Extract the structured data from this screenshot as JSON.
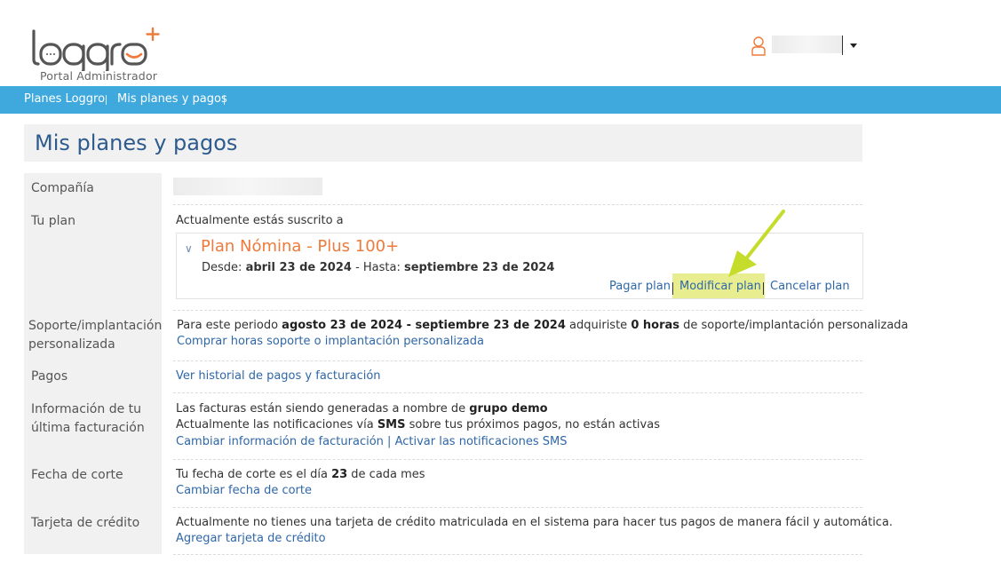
{
  "header": {
    "logo_text": "loggro",
    "logo_subtitle": "Portal Administrador",
    "user_menu": {
      "name": ""
    }
  },
  "breadcrumb": {
    "items": [
      {
        "label": "Planes Loggro"
      },
      {
        "label": "Mis planes y pagos"
      }
    ]
  },
  "page": {
    "title": "Mis planes y pagos"
  },
  "rows": {
    "company": {
      "label": "Compañía",
      "value": ""
    },
    "plan": {
      "label": "Tu plan",
      "intro": "Actualmente estás suscrito a",
      "name": "Plan Nómina - Plus 100+",
      "from_label": "Desde:",
      "from_date": "abril 23 de 2024",
      "sep": " - Hasta: ",
      "to_date": "septiembre 23 de 2024",
      "actions": {
        "pay": "Pagar plan",
        "modify": "Modificar plan",
        "cancel": "Cancelar plan"
      }
    },
    "support": {
      "label_line1": "Soporte/implantación",
      "label_line2": "personalizada",
      "text_1": "Para este periodo ",
      "period": "agosto 23 de 2024 - septiembre 23 de 2024",
      "text_2": " adquiriste ",
      "hours": "0 horas",
      "text_3": " de soporte/implantación personalizada",
      "link": "Comprar horas soporte o implantación personalizada"
    },
    "payments": {
      "label": "Pagos",
      "link": "Ver historial de pagos y facturación"
    },
    "billing": {
      "label_line1": "Información de tu",
      "label_line2": "última facturación",
      "text_1": "Las facturas están siendo generadas a nombre de ",
      "group": "grupo demo",
      "text_2": "Actualmente las notificaciones vía ",
      "sms": "SMS",
      "text_3": " sobre tus próximos pagos, no están activas",
      "link_1": "Cambiar información de facturación",
      "link_sep": " | ",
      "link_2": "Activar las notificaciones SMS"
    },
    "cutoff": {
      "label": "Fecha de corte",
      "text_1": "Tu fecha de corte es el día ",
      "day": "23",
      "text_2": " de cada mes",
      "link": "Cambiar fecha de corte"
    },
    "card": {
      "label": "Tarjeta de crédito",
      "text": "Actualmente no tienes una tarjeta de crédito matriculada en el sistema para hacer tus pagos de manera fácil y automática.",
      "link": "Agregar tarjeta de crédito"
    }
  },
  "colors": {
    "nav_bg": "#3fa9de",
    "title": "#2d5b8e",
    "plan_name": "#ee7a3b",
    "link": "#2f67a8",
    "highlight": "#e8ee8f",
    "arrow": "#c6dc2a"
  }
}
